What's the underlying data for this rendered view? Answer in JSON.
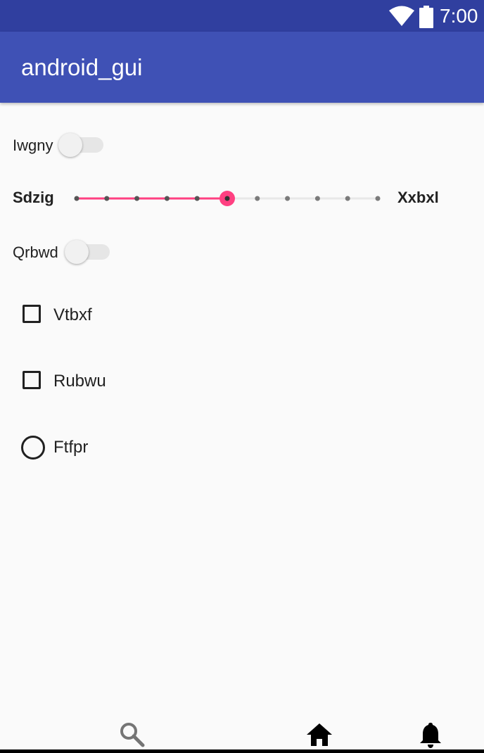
{
  "status_bar": {
    "time": "7:00",
    "icons": [
      "wifi-icon",
      "battery-icon"
    ]
  },
  "app_bar": {
    "title": "android_gui"
  },
  "controls": {
    "switch_1": {
      "label": "Iwgny",
      "checked": false
    },
    "slider": {
      "min_label": "Sdzig",
      "max_label": "Xxbxl",
      "steps": 10,
      "value": 5,
      "accent": "#ff4081"
    },
    "switch_2": {
      "label": "Qrbwd",
      "checked": false
    },
    "checkbox_1": {
      "label": "Vtbxf",
      "checked": false
    },
    "checkbox_2": {
      "label": "Rubwu",
      "checked": false
    },
    "radio_1": {
      "label": "Ftfpr",
      "checked": false
    }
  },
  "bottom_nav": {
    "items": [
      "search-icon",
      "home-icon",
      "bell-icon"
    ]
  },
  "colors": {
    "status_bar": "#303f9f",
    "app_bar": "#3f51b5",
    "accent": "#ff4081",
    "background": "#fafafa"
  }
}
